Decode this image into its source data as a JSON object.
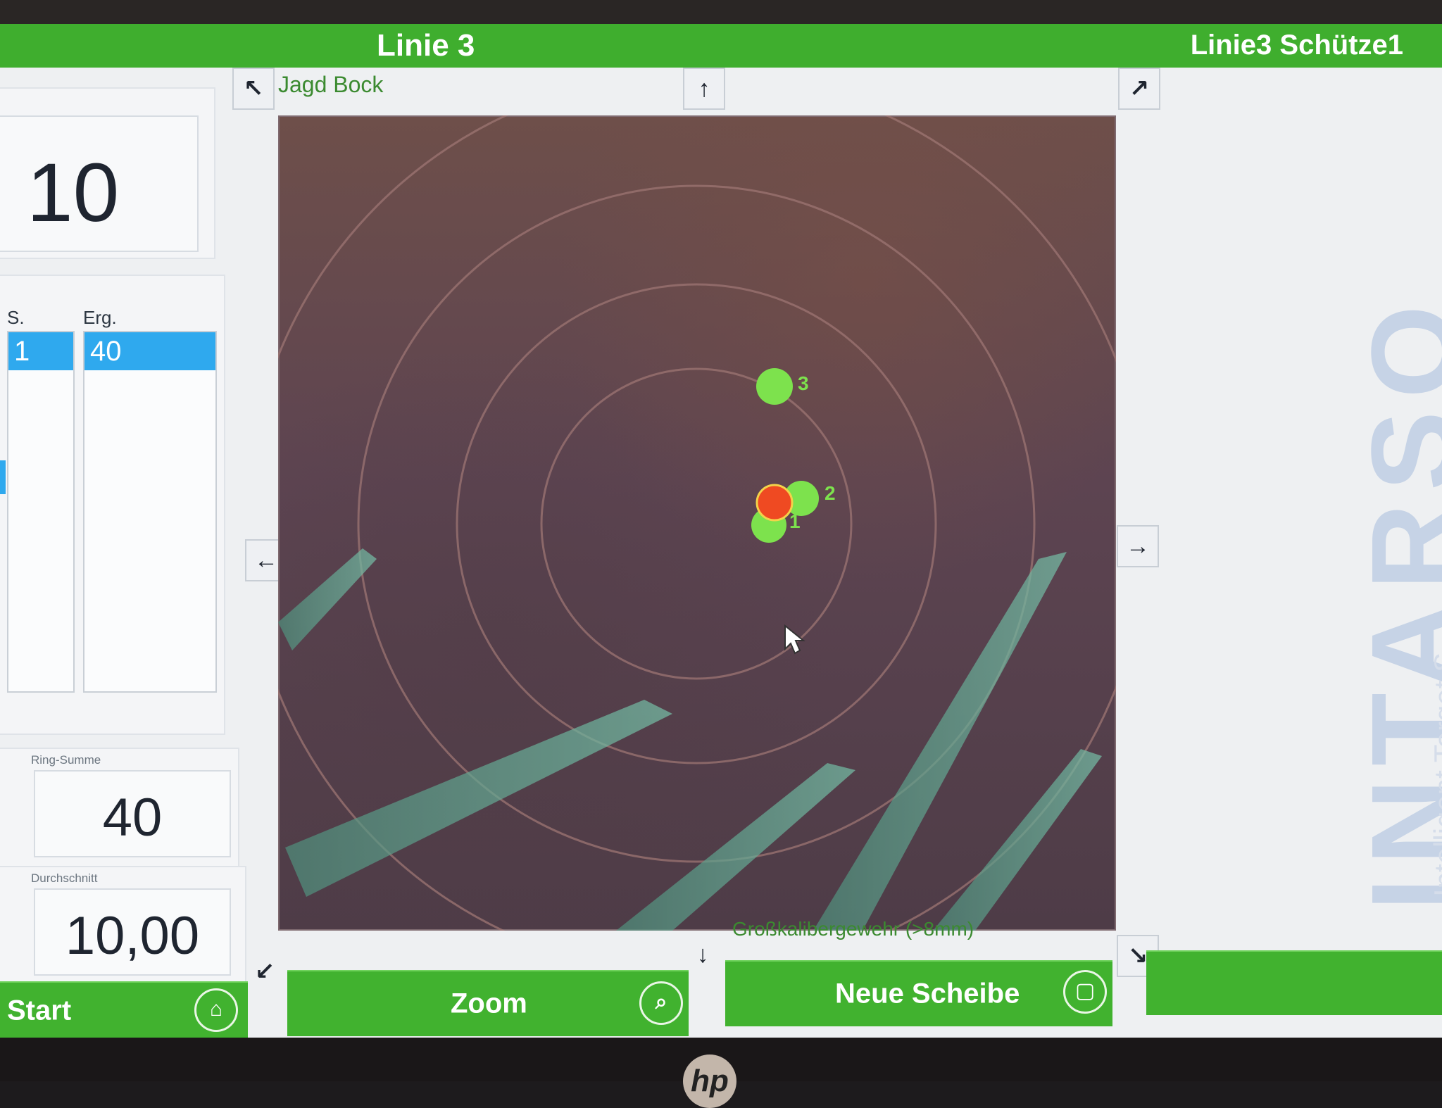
{
  "window": {
    "title_center": "Linie 3",
    "title_right": "Linie3 Schütze1"
  },
  "left_panel": {
    "shot_value": "10",
    "columns": {
      "shot_label": "S.",
      "result_label": "Erg."
    },
    "rows": [
      {
        "shot": "1",
        "result": "40"
      }
    ],
    "ring_sum_label": "Ring-Summe",
    "ring_sum_value": "40",
    "average_label": "Durchschnitt",
    "average_value": "10,00"
  },
  "target": {
    "name": "Jagd Bock",
    "weapon": "Großkalibergewehr (>8mm)",
    "markers": [
      {
        "label": "3",
        "type": "hit"
      },
      {
        "label": "2",
        "type": "hit"
      },
      {
        "label": "1",
        "type": "hit"
      },
      {
        "label": "",
        "type": "current"
      }
    ]
  },
  "buttons": {
    "start": "Start",
    "zoom": "Zoom",
    "new_target": "Neue Scheibe"
  },
  "branding": {
    "logo": "INTARSO",
    "tagline": "Intelligent Target S"
  },
  "icons": {
    "top_left": "↖",
    "top_center": "↑",
    "top_right": "↗",
    "left_center": "←",
    "right_center": "→",
    "bottom_left": "↙",
    "bottom_center": "↓",
    "bottom_right": "↘",
    "home": "⌂",
    "zoom": "⌕",
    "new_target": "▢"
  },
  "colors": {
    "green": "#41b22f",
    "blue_selection": "#2fa9ee",
    "hit_marker": "#7de24d",
    "current_marker": "#ef4a22"
  }
}
